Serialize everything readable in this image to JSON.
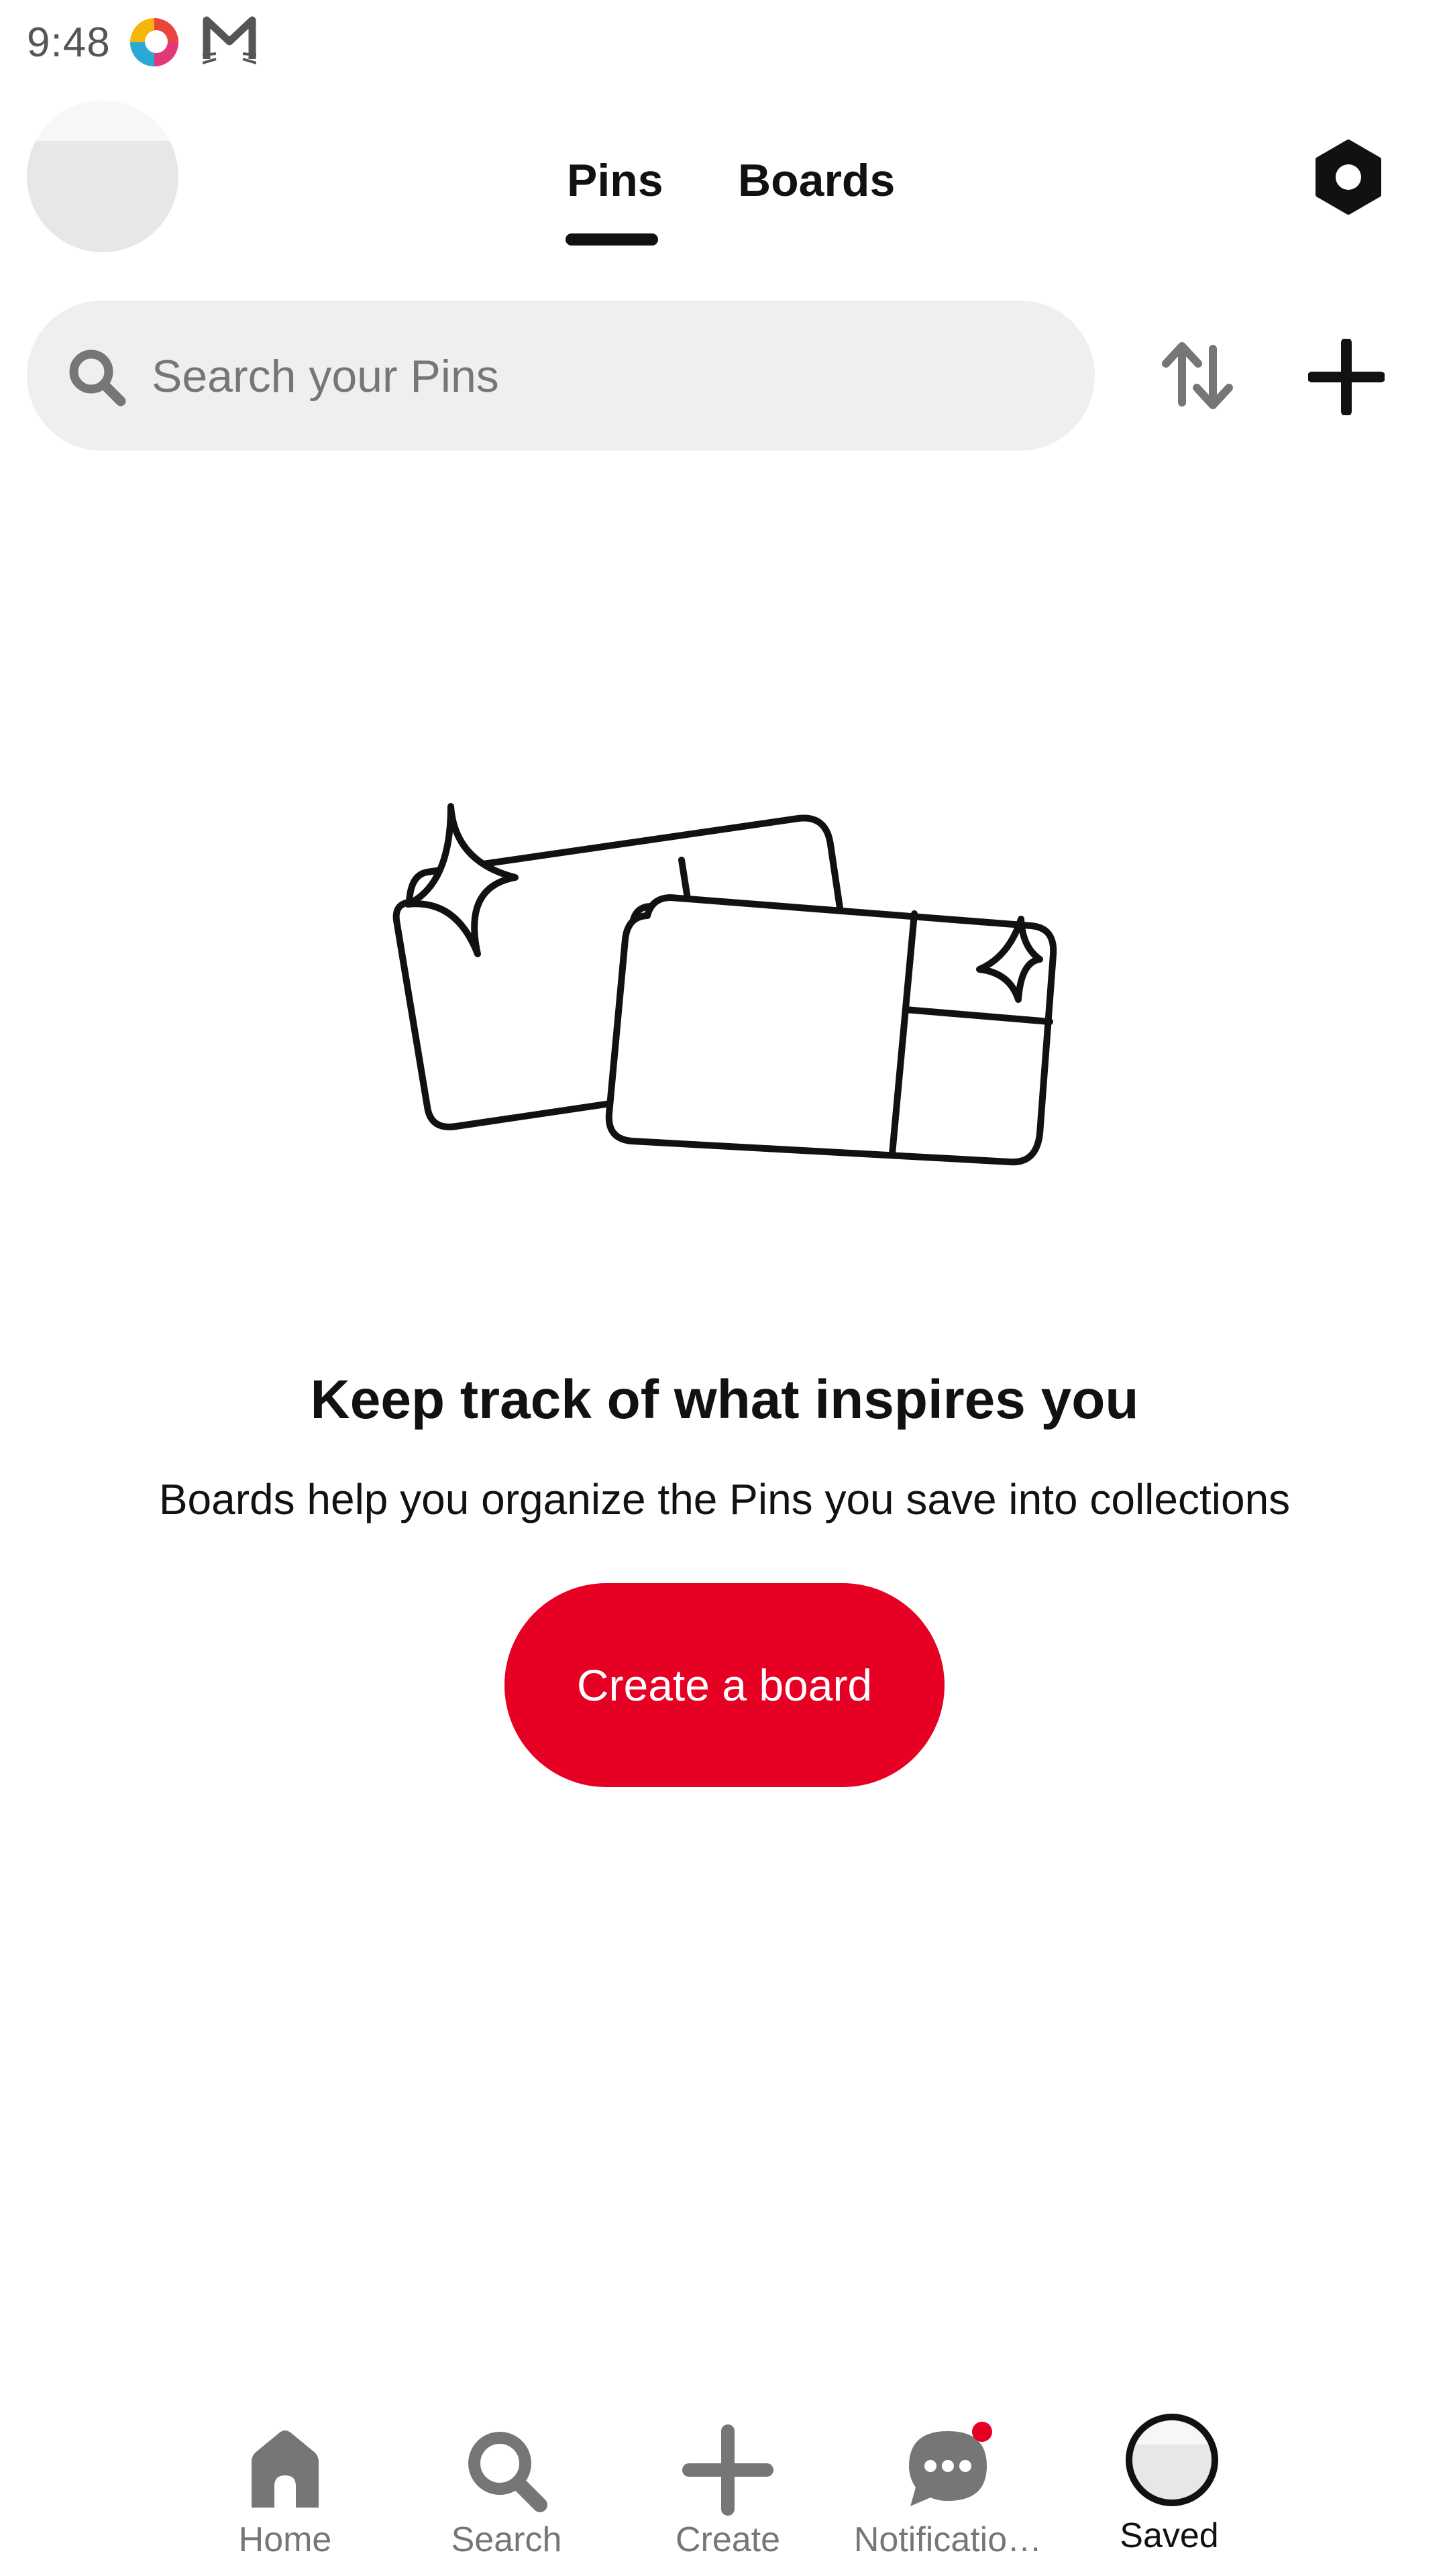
{
  "status_bar": {
    "time": "9:48",
    "notification_icons": [
      "colorful-app-icon",
      "mail-cat-icon"
    ]
  },
  "header": {
    "tabs": [
      {
        "label": "Pins",
        "active": true
      },
      {
        "label": "Boards",
        "active": false
      }
    ],
    "settings_icon": "hexagon-settings-icon"
  },
  "search": {
    "placeholder": "Search your Pins",
    "sort_icon": "sort-arrows-icon",
    "add_icon": "plus-icon"
  },
  "empty_state": {
    "illustration": "boards-sparkle-illustration",
    "title": "Keep track of what inspires you",
    "description": "Boards help you organize the Pins you save into collections",
    "button_label": "Create a board"
  },
  "bottom_nav": {
    "items": [
      {
        "label": "Home",
        "icon": "home-icon",
        "active": false
      },
      {
        "label": "Search",
        "icon": "search-icon",
        "active": false
      },
      {
        "label": "Create",
        "icon": "plus-icon",
        "active": false
      },
      {
        "label": "Notificatio…",
        "icon": "chat-bubble-icon",
        "active": false,
        "has_badge": true
      },
      {
        "label": "Saved",
        "icon": "profile-avatar",
        "active": true
      }
    ]
  },
  "colors": {
    "accent": "#e60023",
    "search_background": "#efefef",
    "text_primary": "#111111",
    "text_secondary": "#767676"
  }
}
